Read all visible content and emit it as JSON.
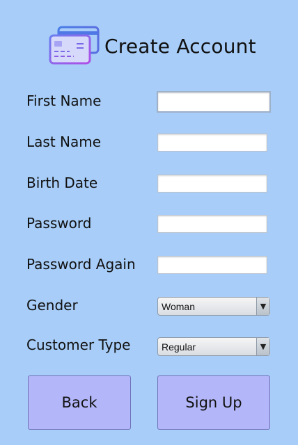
{
  "header": {
    "title": "Create Account",
    "icon": "credit-cards-icon"
  },
  "form": {
    "first_name": {
      "label": "First Name",
      "value": ""
    },
    "last_name": {
      "label": "Last Name",
      "value": ""
    },
    "birth_date": {
      "label": "Birth Date",
      "value": ""
    },
    "password": {
      "label": "Password",
      "value": ""
    },
    "password_again": {
      "label": "Password Again",
      "value": ""
    },
    "gender": {
      "label": "Gender",
      "selected": "Woman"
    },
    "customer_type": {
      "label": "Customer Type",
      "selected": "Regular"
    }
  },
  "buttons": {
    "back": "Back",
    "signup": "Sign Up"
  },
  "colors": {
    "background": "#a7cdf8",
    "button": "#b3b6f8",
    "button_border": "#6f72b8"
  }
}
